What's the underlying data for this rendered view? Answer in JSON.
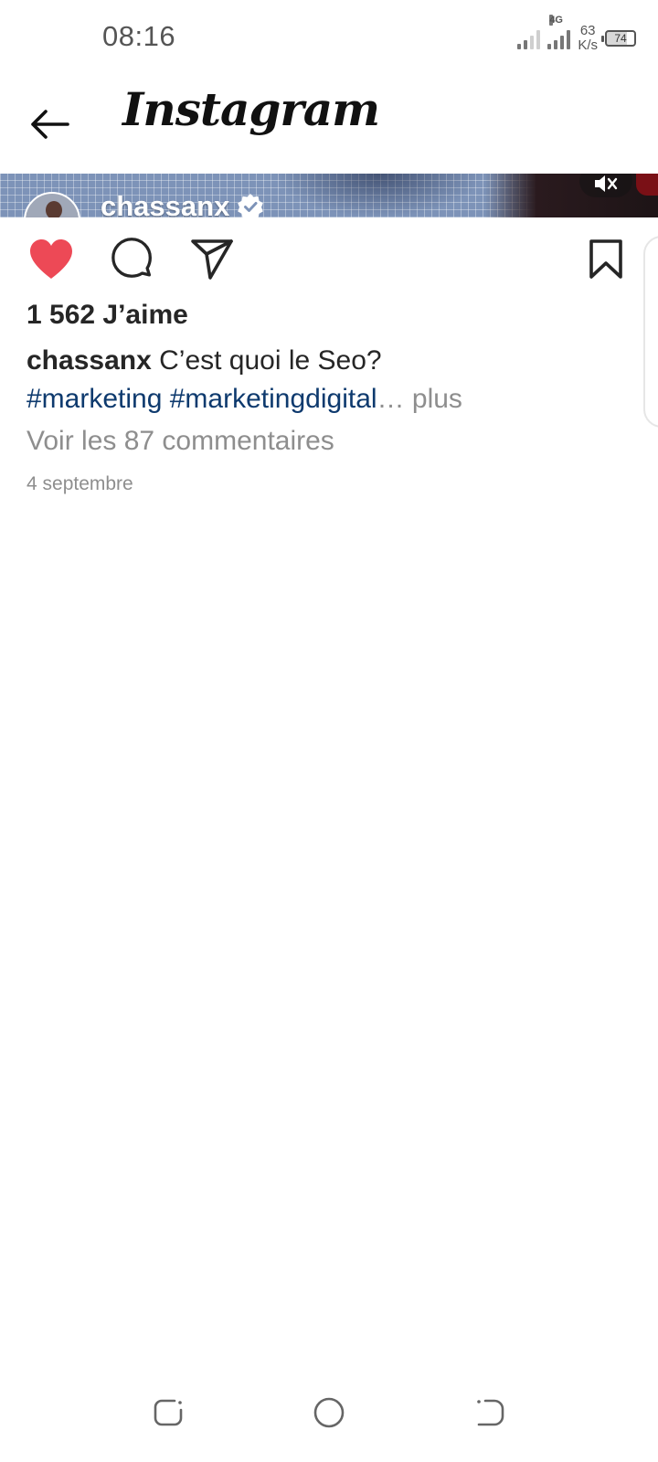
{
  "status_bar": {
    "time": "08:16",
    "network_type": "4G",
    "speed_value": "63",
    "speed_unit": "K/s",
    "battery": "74"
  },
  "header": {
    "app_name": "Instagram",
    "back_icon": "arrow-left-icon"
  },
  "video": {
    "username": "chassanx",
    "verified": true,
    "mute_icon": "speaker-muted-icon"
  },
  "actions": {
    "liked": true,
    "like_color": "#ed4956",
    "icons": [
      "heart-icon",
      "comment-icon",
      "share-icon",
      "bookmark-icon"
    ]
  },
  "post": {
    "likes": "1 562 J’aime",
    "caption_user": "chassanx",
    "caption_text": "C’est quoi le Seo?",
    "hashtags": [
      "#marketing",
      "#marketingdigital"
    ],
    "ellipsis": "…",
    "more_label": "plus",
    "comments_link": "Voir les 87 commentaires",
    "date": "4 septembre"
  },
  "colors": {
    "hashtag": "#0e3a6e",
    "secondary_text": "#8e8e8e",
    "primary_text": "#262626"
  },
  "nav_bar": {
    "icons": [
      "recent-apps-icon",
      "home-icon",
      "back-icon"
    ]
  }
}
